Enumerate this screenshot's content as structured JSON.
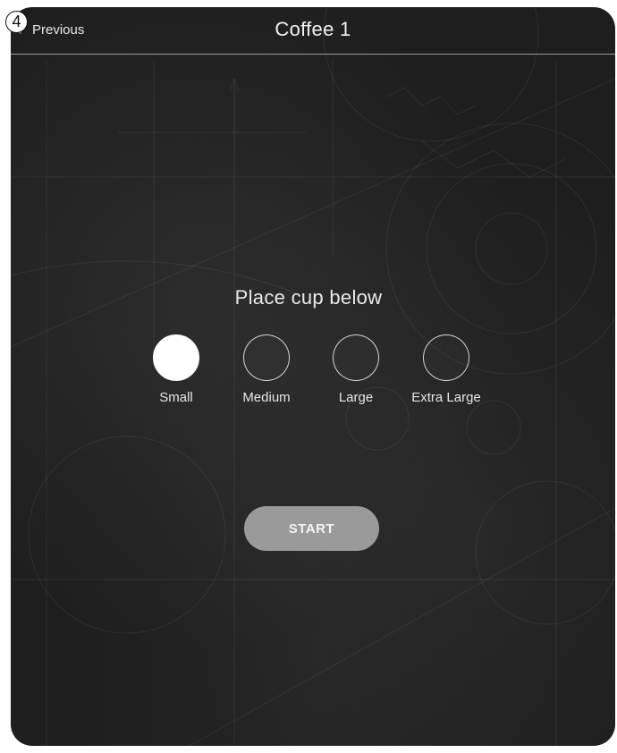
{
  "header": {
    "step_number": "4",
    "back_label": "Previous",
    "title": "Coffee 1"
  },
  "main": {
    "instruction": "Place cup below",
    "cup_sizes": [
      {
        "label": "Small",
        "selected": true
      },
      {
        "label": "Medium",
        "selected": false
      },
      {
        "label": "Large",
        "selected": false
      },
      {
        "label": "Extra Large",
        "selected": false
      }
    ],
    "start_label": "START"
  },
  "colors": {
    "background": "#1e1e1e",
    "text": "#eaeaea",
    "selected_fill": "#ffffff",
    "start_button": "#9a9a9a"
  }
}
